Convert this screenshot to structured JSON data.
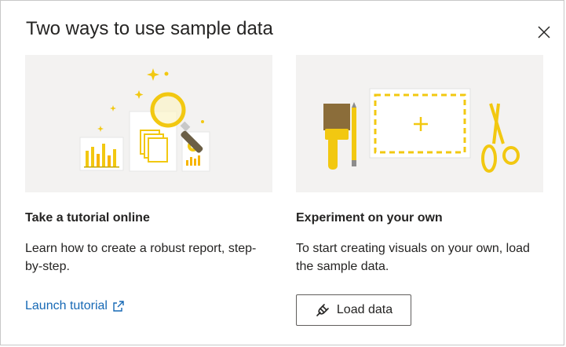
{
  "dialog": {
    "title": "Two ways to use sample data",
    "close_icon": "close-icon"
  },
  "tutorial_card": {
    "heading": "Take a tutorial online",
    "description": "Learn how to create a robust report, step-by-step.",
    "link_label": "Launch tutorial",
    "link_icon": "external-link-icon",
    "illustration": "magnifier-reports-illustration"
  },
  "experiment_card": {
    "heading": "Experiment on your own",
    "description": "To start creating visuals on your own, load the sample data.",
    "button_label": "Load data",
    "button_icon": "plug-icon",
    "illustration": "brush-canvas-scissors-illustration"
  },
  "colors": {
    "accent_yellow": "#f2c811",
    "link_blue": "#1769b5",
    "illustration_bg": "#f3f2f1",
    "text": "#252423"
  }
}
